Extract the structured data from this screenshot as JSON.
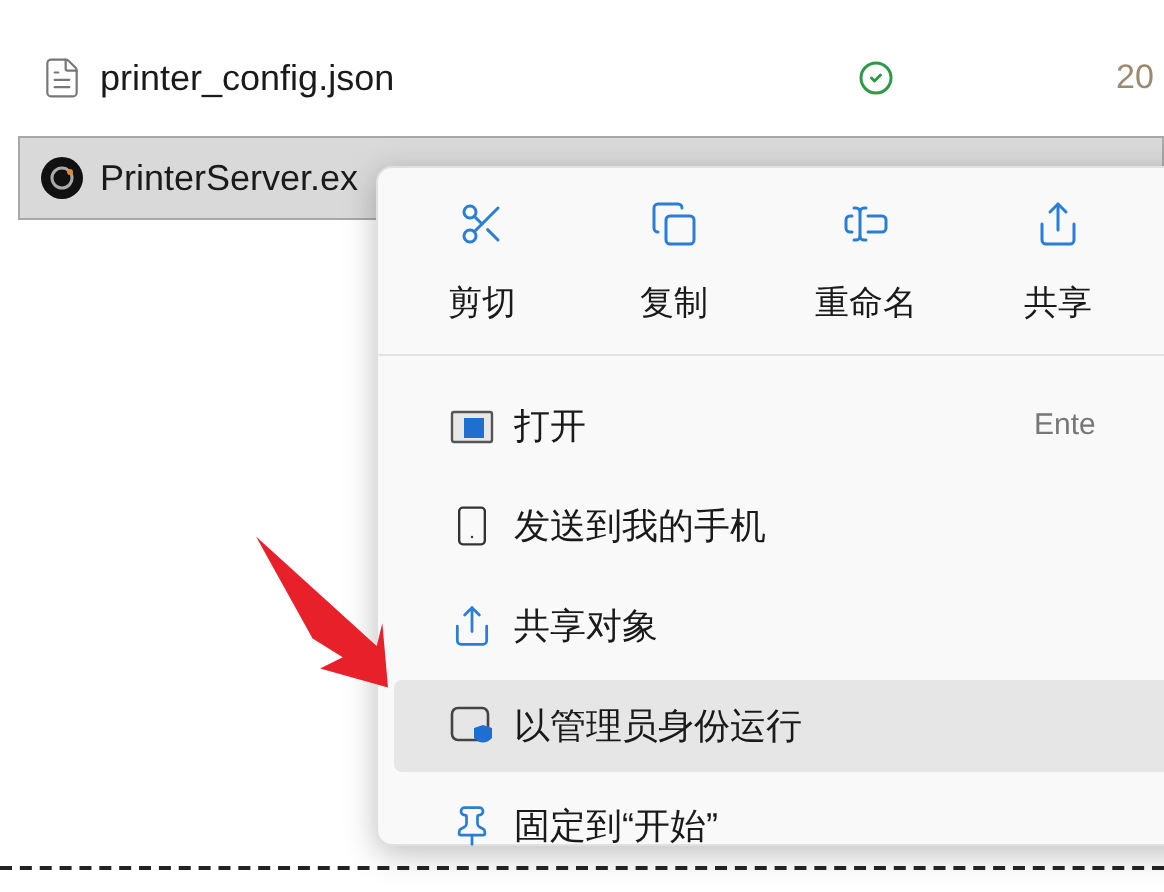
{
  "files": [
    {
      "name": "printer_config.json",
      "kind": "document",
      "selected": false,
      "synced": true,
      "date": "20"
    },
    {
      "name": "PrinterServer.ex",
      "kind": "program",
      "selected": true
    }
  ],
  "context_menu": {
    "toolbar": [
      {
        "label": "剪切",
        "kind": "cut"
      },
      {
        "label": "复制",
        "kind": "copy"
      },
      {
        "label": "重命名",
        "kind": "rename"
      },
      {
        "label": "共享",
        "kind": "share"
      }
    ],
    "items": [
      {
        "label": "打开",
        "kind": "open",
        "shortcut": "Ente",
        "highlighted": false
      },
      {
        "label": "发送到我的手机",
        "kind": "phone",
        "highlighted": false
      },
      {
        "label": "共享对象",
        "kind": "share",
        "highlighted": false
      },
      {
        "label": "以管理员身份运行",
        "kind": "admin",
        "highlighted": true
      },
      {
        "label": "固定到“开始”",
        "kind": "pin",
        "highlighted": false
      }
    ]
  }
}
